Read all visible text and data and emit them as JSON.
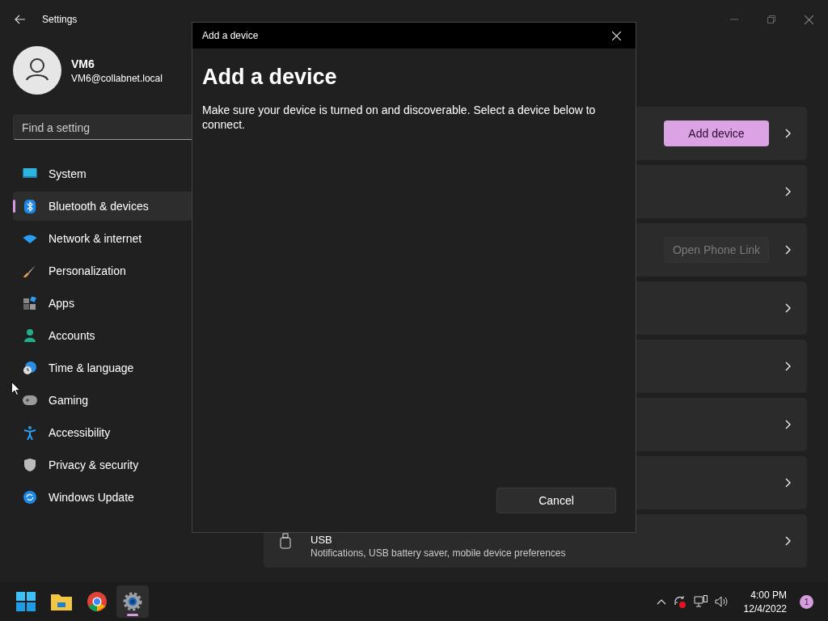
{
  "window": {
    "title": "Settings"
  },
  "account": {
    "name": "VM6",
    "email": "VM6@collabnet.local"
  },
  "search": {
    "placeholder": "Find a setting"
  },
  "nav": [
    {
      "label": "System",
      "selected": false
    },
    {
      "label": "Bluetooth & devices",
      "selected": true
    },
    {
      "label": "Network & internet",
      "selected": false
    },
    {
      "label": "Personalization",
      "selected": false
    },
    {
      "label": "Apps",
      "selected": false
    },
    {
      "label": "Accounts",
      "selected": false
    },
    {
      "label": "Time & language",
      "selected": false
    },
    {
      "label": "Gaming",
      "selected": false
    },
    {
      "label": "Accessibility",
      "selected": false
    },
    {
      "label": "Privacy & security",
      "selected": false
    },
    {
      "label": "Windows Update",
      "selected": false
    }
  ],
  "cards": [
    {
      "kind": "button",
      "button": {
        "label": "Add device",
        "disabled": false
      }
    },
    {
      "kind": "blank"
    },
    {
      "kind": "button",
      "button": {
        "label": "Open Phone Link",
        "disabled": true
      }
    },
    {
      "kind": "blank"
    },
    {
      "kind": "blank"
    },
    {
      "kind": "blank"
    },
    {
      "kind": "blank"
    },
    {
      "kind": "text",
      "title": "USB",
      "description": "Notifications, USB battery saver, mobile device preferences"
    }
  ],
  "dialog": {
    "title": "Add a device",
    "heading": "Add a device",
    "message": "Make sure your device is turned on and discoverable. Select a device below to connect.",
    "cancel": "Cancel"
  },
  "taskbar": {
    "apps": [
      {
        "selected": false
      },
      {
        "selected": false
      },
      {
        "selected": false
      },
      {
        "selected": true
      }
    ],
    "time": "4:00 PM",
    "date": "12/4/2022",
    "notifications": "1"
  }
}
